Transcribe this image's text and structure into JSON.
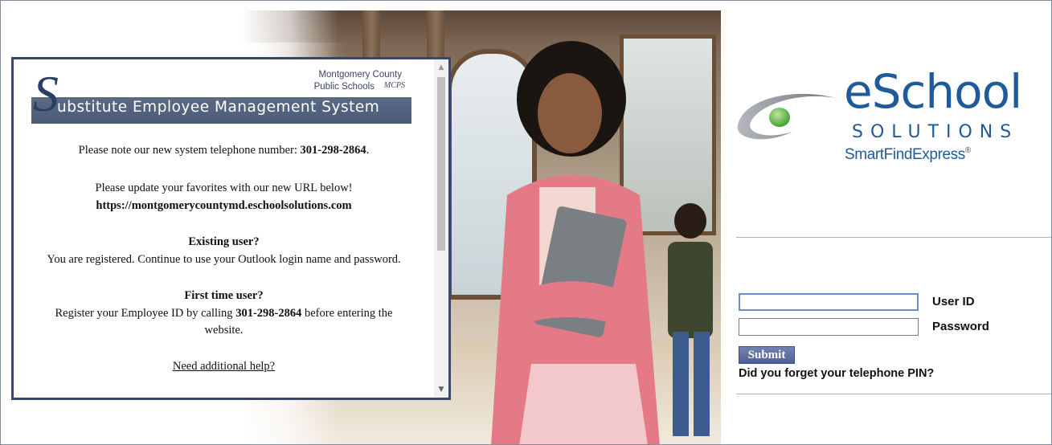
{
  "banner": {
    "org_line1": "Montgomery County",
    "org_line2": "Public Schools",
    "org_logo_text": "MCPS",
    "big_letter": "S",
    "title_rest": "ubstitute Employee Management System"
  },
  "messages": {
    "phone_note_prefix": "Please note our new system telephone number: ",
    "phone_number": "301-298-2864",
    "phone_note_suffix": ".",
    "url_note": "Please update your favorites with our new URL below!",
    "url": "https://montgomerycountymd.eschoolsolutions.com",
    "existing_heading": "Existing user?",
    "existing_text": "You are registered. Continue to use your Outlook login name and password.",
    "first_heading": "First time user?",
    "first_text_prefix": "Register your Employee ID by calling ",
    "first_phone": "301-298-2864",
    "first_text_suffix_line1": " before entering the",
    "first_text_line2": "website.",
    "help_link": "Need additional help?"
  },
  "scrollbar": {
    "up_arrow": "▲",
    "down_arrow": "▼"
  },
  "brand": {
    "name_main": "eSchool",
    "name_sub": "SOLUTIONS",
    "product": "SmartFindExpress",
    "registered": "®"
  },
  "login": {
    "user_id_label": "User ID",
    "password_label": "Password",
    "user_id_value": "",
    "password_value": "",
    "submit_label": "Submit",
    "forgot_link": "Did you forget your telephone PIN?"
  },
  "colors": {
    "panel_border": "#3a4671",
    "banner_bar": "#4b5a76",
    "brand_blue": "#1f5a9a",
    "submit_bg": "#4e5f92",
    "input_focus": "#6e8bd1"
  }
}
